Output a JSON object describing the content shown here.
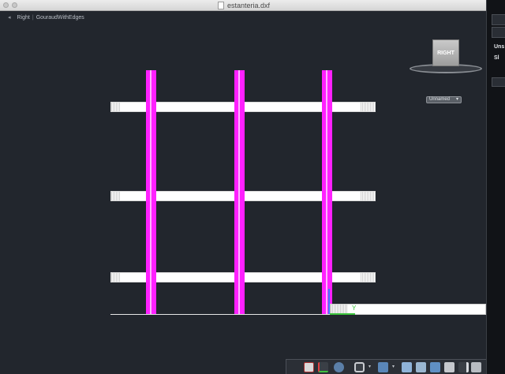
{
  "window": {
    "title": "estanteria.dxf"
  },
  "viewport": {
    "view_arrow": "◂",
    "view_name": "Right",
    "visual_style": "GouraudWithEdges"
  },
  "viewcube": {
    "face": "RIGHT",
    "named_view": "Unnamed"
  },
  "axis": {
    "y_label": "Y"
  },
  "right_panel": {
    "label_1": "Uns",
    "label_2": "Sl"
  },
  "colors": {
    "background": "#22262d",
    "post": "#ff20ff",
    "shelf": "#ffffff",
    "axis_z": "#3d7dff",
    "axis_y": "#3cc43c"
  },
  "icons": {
    "toolbar": [
      "insert-icon",
      "ucs-icon",
      "orbit-icon",
      "visual-style-icon",
      "dropdown-icon",
      "layer-icon",
      "dropdown-icon",
      "render-icon",
      "material-icon",
      "light-icon",
      "sun-icon",
      "pencil-icon",
      "camera-icon",
      "gear-icon"
    ]
  }
}
